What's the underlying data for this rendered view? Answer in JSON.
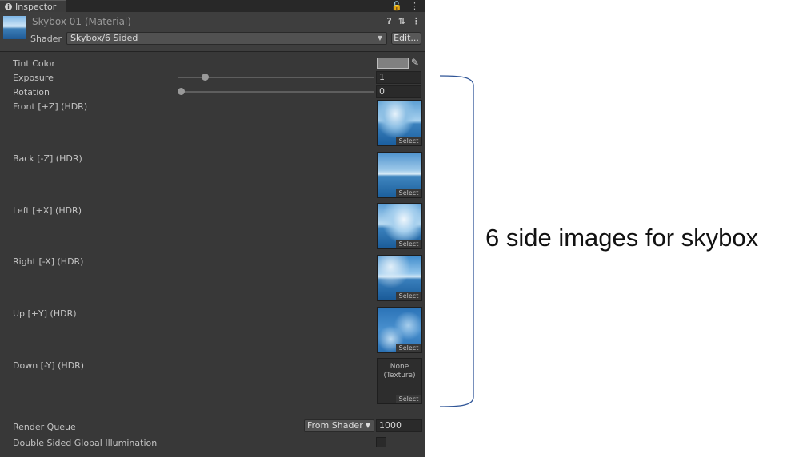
{
  "tab": {
    "label": "Inspector",
    "lock_glyph": "🔓",
    "menu_glyph": "⋮"
  },
  "material": {
    "title": "Skybox 01 (Material)",
    "help_glyph": "?",
    "settings_glyph": "⇅",
    "menu_glyph": "⋮",
    "shader_label": "Shader",
    "shader_value": "Skybox/6 Sided",
    "edit_label": "Edit..."
  },
  "properties": {
    "tint_color": {
      "label": "Tint Color",
      "swatch_color": "#808080"
    },
    "exposure": {
      "label": "Exposure",
      "value": "1",
      "slider_fraction": 0.125
    },
    "rotation": {
      "label": "Rotation",
      "value": "0",
      "slider_fraction": 0
    }
  },
  "textures": [
    {
      "label": "Front [+Z]   (HDR)",
      "state": "sky1",
      "select_label": "Select"
    },
    {
      "label": "Back [-Z]   (HDR)",
      "state": "sky2",
      "select_label": "Select"
    },
    {
      "label": "Left [+X]   (HDR)",
      "state": "sky3",
      "select_label": "Select"
    },
    {
      "label": "Right [-X]   (HDR)",
      "state": "sky4",
      "select_label": "Select"
    },
    {
      "label": "Up [+Y]   (HDR)",
      "state": "sky5",
      "select_label": "Select"
    },
    {
      "label": "Down [-Y]   (HDR)",
      "state": "none",
      "none_text": "None\n(Texture)",
      "select_label": "Select"
    }
  ],
  "render_queue": {
    "label": "Render Queue",
    "mode": "From Shader",
    "value": "1000"
  },
  "double_sided_gi": {
    "label": "Double Sided Global Illumination",
    "checked": false
  },
  "annotation": {
    "text": "6 side images for skybox",
    "bracket_color": "#2f5597"
  }
}
